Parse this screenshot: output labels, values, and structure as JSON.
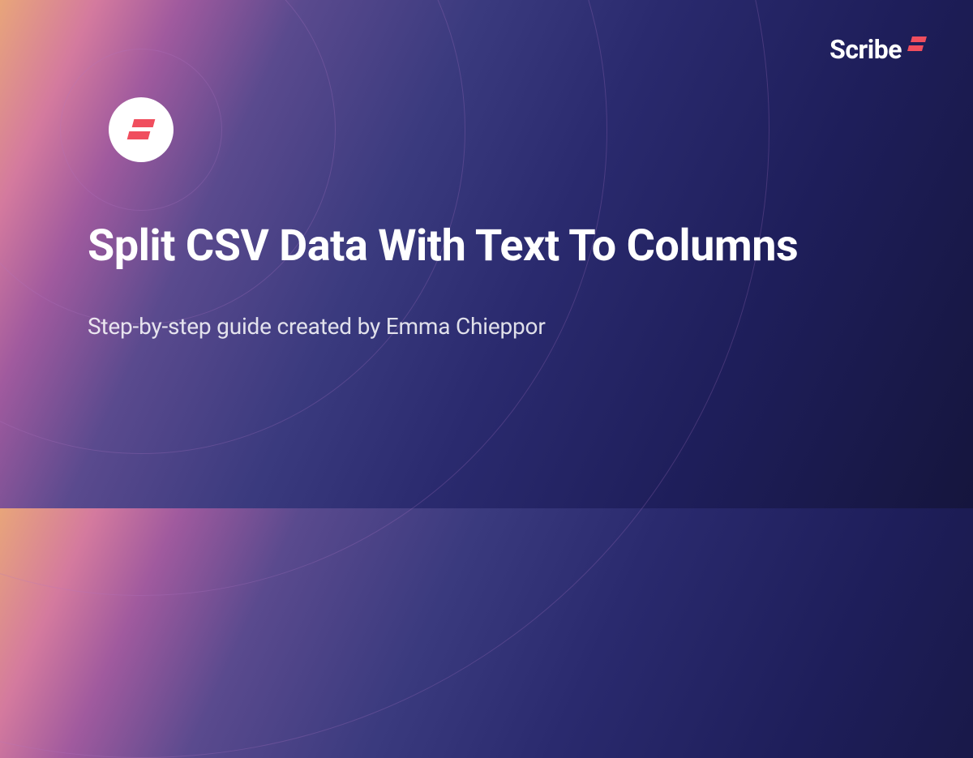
{
  "card": {
    "title": "Split CSV Data With Text To Columns",
    "subtitle": "Step-by-step guide created by Emma Chieppor"
  },
  "brand": {
    "name": "Scribe"
  }
}
